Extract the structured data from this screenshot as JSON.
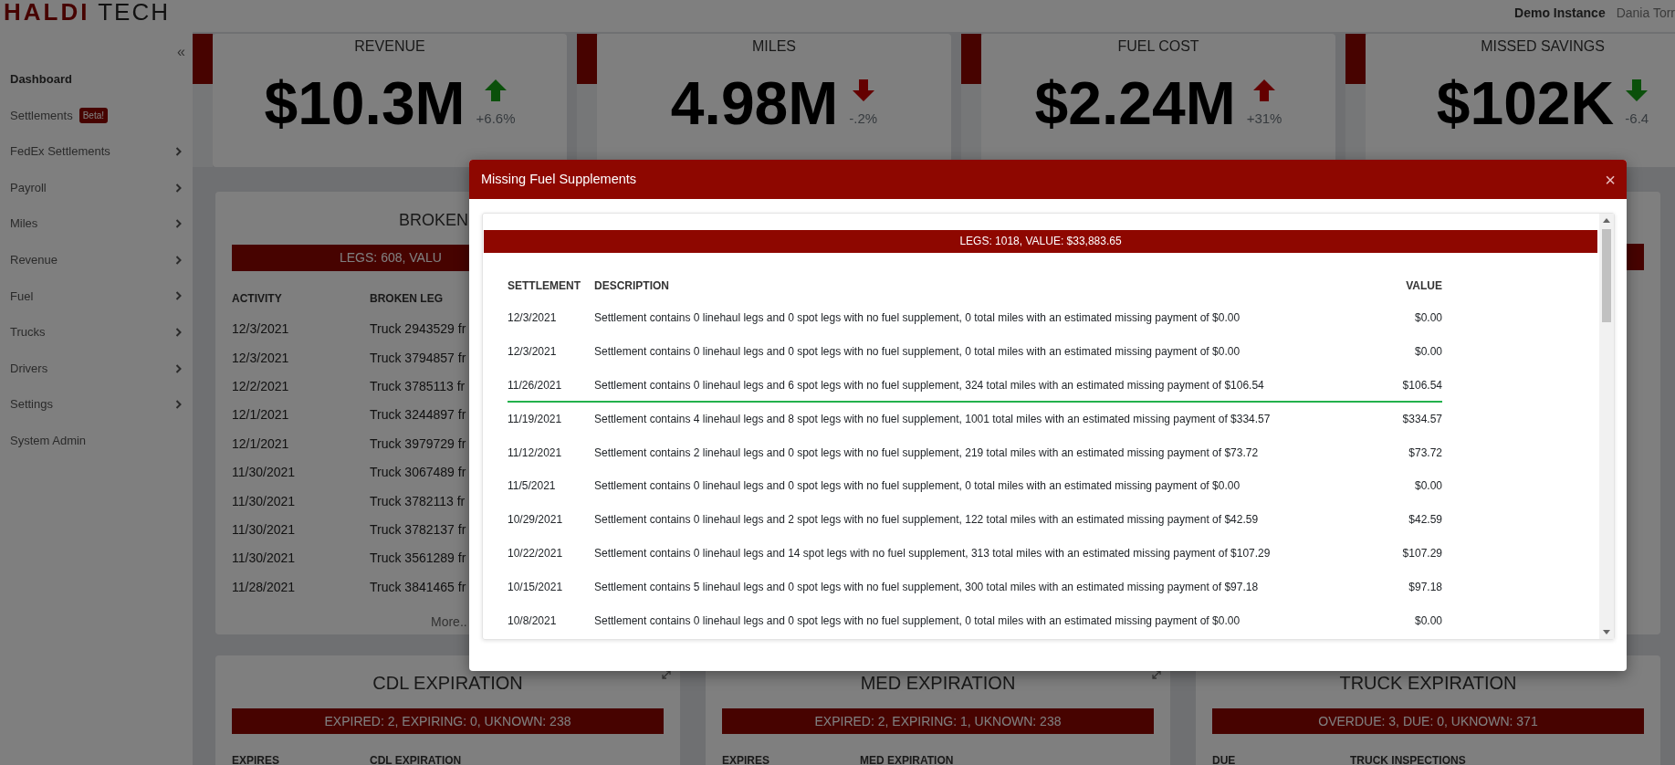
{
  "header": {
    "logo": "**HALDI** TECH",
    "instance": "Demo Instance",
    "user": "Dania Torr"
  },
  "sidebar": {
    "collapse": "«",
    "items": [
      {
        "label": "Dashboard",
        "selected": true,
        "has_children": false
      },
      {
        "label": "Settlements",
        "badge": "Beta!",
        "selected": false,
        "has_children": false
      },
      {
        "label": "FedEx Settlements",
        "selected": false,
        "has_children": true
      },
      {
        "label": "Payroll",
        "selected": false,
        "has_children": true
      },
      {
        "label": "Miles",
        "selected": false,
        "has_children": true
      },
      {
        "label": "Revenue",
        "selected": false,
        "has_children": true
      },
      {
        "label": "Fuel",
        "selected": false,
        "has_children": true
      },
      {
        "label": "Trucks",
        "selected": false,
        "has_children": true
      },
      {
        "label": "Drivers",
        "selected": false,
        "has_children": true
      },
      {
        "label": "Settings",
        "selected": false,
        "has_children": true
      },
      {
        "label": "System Admin",
        "selected": false,
        "has_children": false
      }
    ]
  },
  "kpis": [
    {
      "title": "REVENUE",
      "value": "$10.3M",
      "change": "+6.6%",
      "rising": true,
      "favorable": true,
      "level": 0.38
    },
    {
      "title": "MILES",
      "value": "4.98M",
      "change": "-.2%",
      "rising": false,
      "favorable": false,
      "level": 0.38
    },
    {
      "title": "FUEL COST",
      "value": "$2.24M",
      "change": "+31%",
      "rising": true,
      "favorable": false,
      "level": 0.38
    },
    {
      "title": "MISSED SAVINGS",
      "value": "$102K",
      "change": "-6.4",
      "rising": false,
      "favorable": true,
      "level": 0.38
    }
  ],
  "broken_legs": {
    "title": "BROKEN",
    "summary": "LEGS: 608, VALU",
    "columns": [
      "ACTIVITY",
      "BROKEN LEG"
    ],
    "rows": [
      [
        "12/3/2021",
        "Truck 2943529 fr"
      ],
      [
        "12/3/2021",
        "Truck 3794857 fr"
      ],
      [
        "12/2/2021",
        "Truck 3785113 fr"
      ],
      [
        "12/1/2021",
        "Truck 3244897 fr"
      ],
      [
        "12/1/2021",
        "Truck 3979729 fr"
      ],
      [
        "11/30/2021",
        "Truck 3067489 fr"
      ],
      [
        "11/30/2021",
        "Truck 3782113 fr"
      ],
      [
        "11/30/2021",
        "Truck 3782137 fr"
      ],
      [
        "11/30/2021",
        "Truck 3561289 fr"
      ],
      [
        "11/28/2021",
        "Truck 3841465 fr"
      ]
    ],
    "more": "More.."
  },
  "expiration_cards": [
    {
      "title": "CDL EXPIRATION",
      "summary": "EXPIRED: 2, EXPIRING: 0, UKNOWN: 238",
      "columns": [
        "EXPIRES",
        "CDL EXPIRATION"
      ],
      "expandable": true
    },
    {
      "title": "MED EXPIRATION",
      "summary": "EXPIRED: 2, EXPIRING: 1, UKNOWN: 238",
      "columns": [
        "EXPIRES",
        "MED EXPIRATION"
      ],
      "expandable": true
    },
    {
      "title": "TRUCK EXPIRATION",
      "summary": "OVERDUE: 3, DUE: 0, UKNOWN: 371",
      "columns": [
        "DUE",
        "TRUCK INSPECTIONS"
      ],
      "expandable": false
    }
  ],
  "modal": {
    "title": "Missing Fuel Supplements",
    "close": "×",
    "summary": "LEGS: 1018, VALUE: $33,883.65",
    "columns": [
      "SETTLEMENT",
      "DESCRIPTION",
      "VALUE"
    ],
    "rows": [
      {
        "settlement": "12/3/2021",
        "description": "Settlement contains 0 linehaul legs and 0 spot legs with no fuel supplement, 0 total miles with an estimated missing payment of $0.00",
        "value": "$0.00",
        "selected": false
      },
      {
        "settlement": "12/3/2021",
        "description": "Settlement contains 0 linehaul legs and 0 spot legs with no fuel supplement, 0 total miles with an estimated missing payment of $0.00",
        "value": "$0.00",
        "selected": false
      },
      {
        "settlement": "11/26/2021",
        "description": "Settlement contains 0 linehaul legs and 6 spot legs with no fuel supplement, 324 total miles with an estimated missing payment of $106.54",
        "value": "$106.54",
        "selected": true
      },
      {
        "settlement": "11/19/2021",
        "description": "Settlement contains 4 linehaul legs and 8 spot legs with no fuel supplement, 1001 total miles with an estimated missing payment of $334.57",
        "value": "$334.57",
        "selected": false
      },
      {
        "settlement": "11/12/2021",
        "description": "Settlement contains 2 linehaul legs and 0 spot legs with no fuel supplement, 219 total miles with an estimated missing payment of $73.72",
        "value": "$73.72",
        "selected": false
      },
      {
        "settlement": "11/5/2021",
        "description": "Settlement contains 0 linehaul legs and 0 spot legs with no fuel supplement, 0 total miles with an estimated missing payment of $0.00",
        "value": "$0.00",
        "selected": false
      },
      {
        "settlement": "10/29/2021",
        "description": "Settlement contains 0 linehaul legs and 2 spot legs with no fuel supplement, 122 total miles with an estimated missing payment of $42.59",
        "value": "$42.59",
        "selected": false
      },
      {
        "settlement": "10/22/2021",
        "description": "Settlement contains 0 linehaul legs and 14 spot legs with no fuel supplement, 313 total miles with an estimated missing payment of $107.29",
        "value": "$107.29",
        "selected": false
      },
      {
        "settlement": "10/15/2021",
        "description": "Settlement contains 5 linehaul legs and 0 spot legs with no fuel supplement, 300 total miles with an estimated missing payment of $97.18",
        "value": "$97.18",
        "selected": false
      },
      {
        "settlement": "10/8/2021",
        "description": "Settlement contains 0 linehaul legs and 0 spot legs with no fuel supplement, 0 total miles with an estimated missing payment of $0.00",
        "value": "$0.00",
        "selected": false
      }
    ]
  }
}
